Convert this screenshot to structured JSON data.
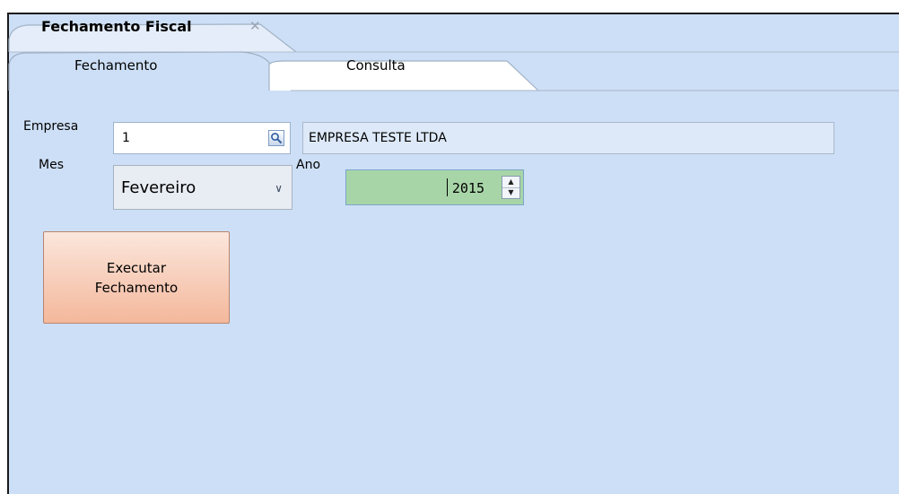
{
  "outer_tab": {
    "title": "Fechamento Fiscal",
    "close_symbol": "✕"
  },
  "inner_tabs": [
    {
      "label": "Fechamento",
      "active": true
    },
    {
      "label": "Consulta",
      "active": false
    }
  ],
  "form": {
    "empresa_label": "Empresa",
    "empresa_code": "1",
    "empresa_search_icon": "magnifier-icon",
    "empresa_name": "EMPRESA TESTE LTDA",
    "mes_label": "Mes",
    "mes_value": "Fevereiro",
    "ano_label": "Ano",
    "ano_value": "2015"
  },
  "actions": {
    "execute_label": "Executar\nFechamento"
  },
  "colors": {
    "panel_background": "#cddff6",
    "year_field": "#a8d5a8",
    "execute_button": "#f4b89c"
  }
}
